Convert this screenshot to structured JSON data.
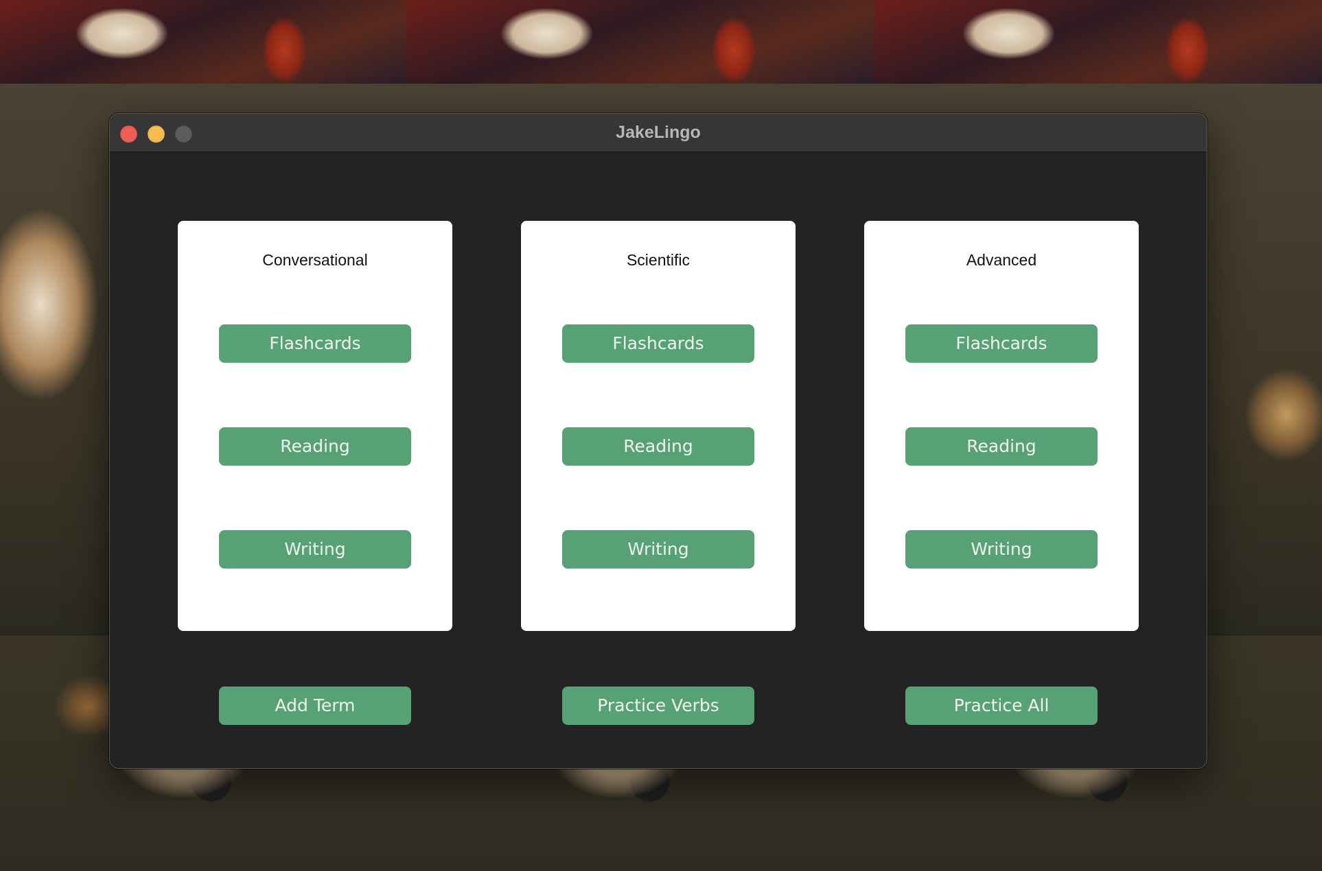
{
  "window": {
    "title": "JakeLingo"
  },
  "cards": [
    {
      "title": "Conversational",
      "buttons": [
        "Flashcards",
        "Reading",
        "Writing"
      ]
    },
    {
      "title": "Scientific",
      "buttons": [
        "Flashcards",
        "Reading",
        "Writing"
      ]
    },
    {
      "title": "Advanced",
      "buttons": [
        "Flashcards",
        "Reading",
        "Writing"
      ]
    }
  ],
  "actions": [
    "Add Term",
    "Practice Verbs",
    "Practice All"
  ],
  "colors": {
    "accent_button": "#56a274",
    "window_background": "#232323",
    "titlebar": "#363636",
    "card_background": "#ffffff",
    "close": "#ee5d54",
    "minimize": "#f4bd4e",
    "zoom_inactive": "#5c5c5c"
  }
}
